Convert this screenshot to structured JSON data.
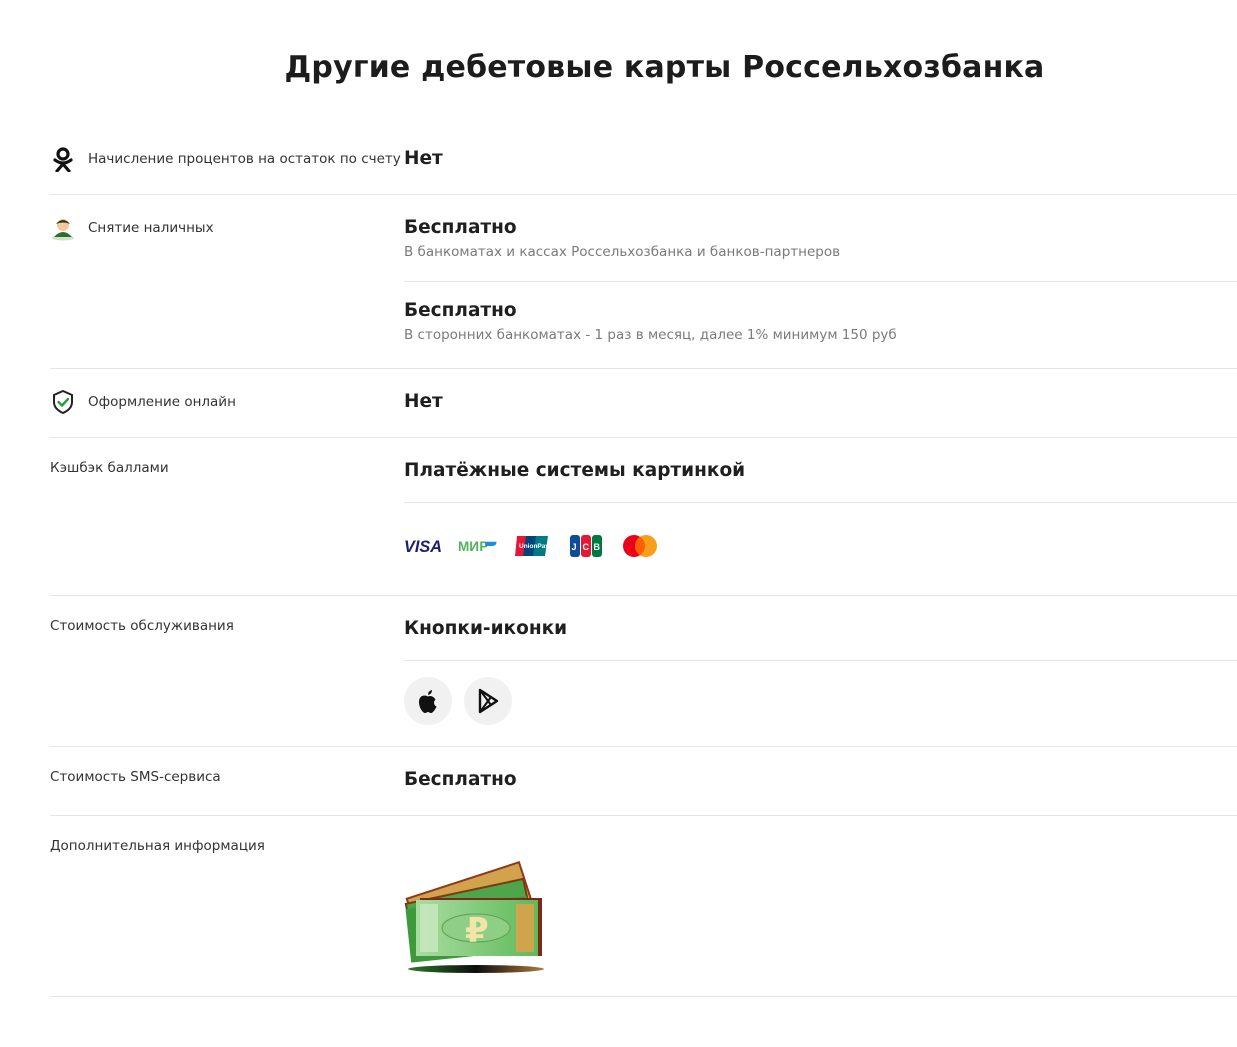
{
  "page": {
    "title": "Другие дебетовые карты Россельхозбанка"
  },
  "rows": {
    "interest": {
      "label": "Начисление процентов на остаток по счету",
      "value": "Нет",
      "icon": "ok-ru-icon"
    },
    "cash": {
      "label": "Снятие наличных",
      "icon": "person-avatar-icon",
      "items": [
        {
          "value": "Бесплатно",
          "note": "В банкоматах и кассах Россельхозбанка и банков-партнеров"
        },
        {
          "value": "Бесплатно",
          "note": "В сторонних банкоматах - 1 раз в месяц, далее 1% минимум 150 руб"
        }
      ]
    },
    "online": {
      "label": "Оформление онлайн",
      "value": "Нет",
      "icon": "shield-check-icon"
    },
    "cashback": {
      "label": "Кэшбэк баллами",
      "value": "Платёжные системы картинкой",
      "payment_systems": [
        "VISA",
        "МИР",
        "UnionPay",
        "JCB",
        "Mastercard"
      ]
    },
    "service": {
      "label": "Стоимость обслуживания",
      "value": "Кнопки-иконки",
      "buttons": [
        "apple-icon",
        "google-play-icon"
      ]
    },
    "sms": {
      "label": "Стоимость SMS-сервиса",
      "value": "Бесплатно"
    },
    "extra": {
      "label": "Дополнительная информация",
      "image": "money-ruble-icon"
    }
  },
  "colors": {
    "visa": "#1a1f71",
    "mir": "#4db45e",
    "shield": "#2e7d32",
    "money_green": "#5ab55d",
    "money_border": "#8b3a1a"
  }
}
